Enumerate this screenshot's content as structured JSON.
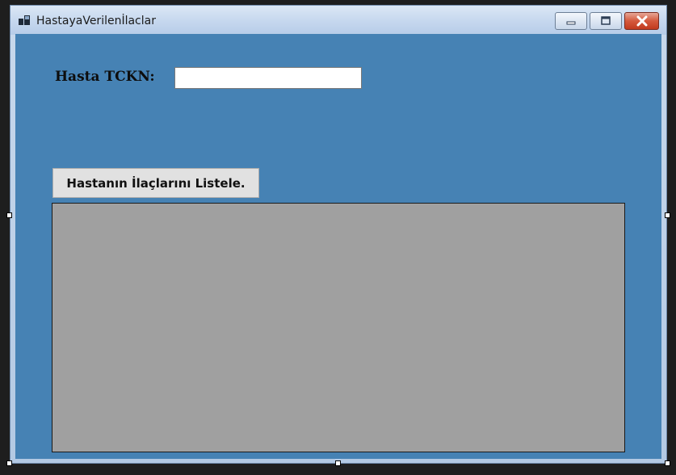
{
  "window": {
    "title": "HastayaVerilenİlaclar",
    "icon": "app-form-icon",
    "caption_buttons": [
      "minimize-icon",
      "maximize-icon",
      "close-icon"
    ]
  },
  "form": {
    "tckn_label": "Hasta TCKN:",
    "tckn_value": "",
    "list_button_label": "Hastanın İlaçlarını Listele."
  },
  "colors": {
    "client_background": "#4682b4",
    "grid_background": "#a0a0a0",
    "close_button": "#c23a1e"
  }
}
